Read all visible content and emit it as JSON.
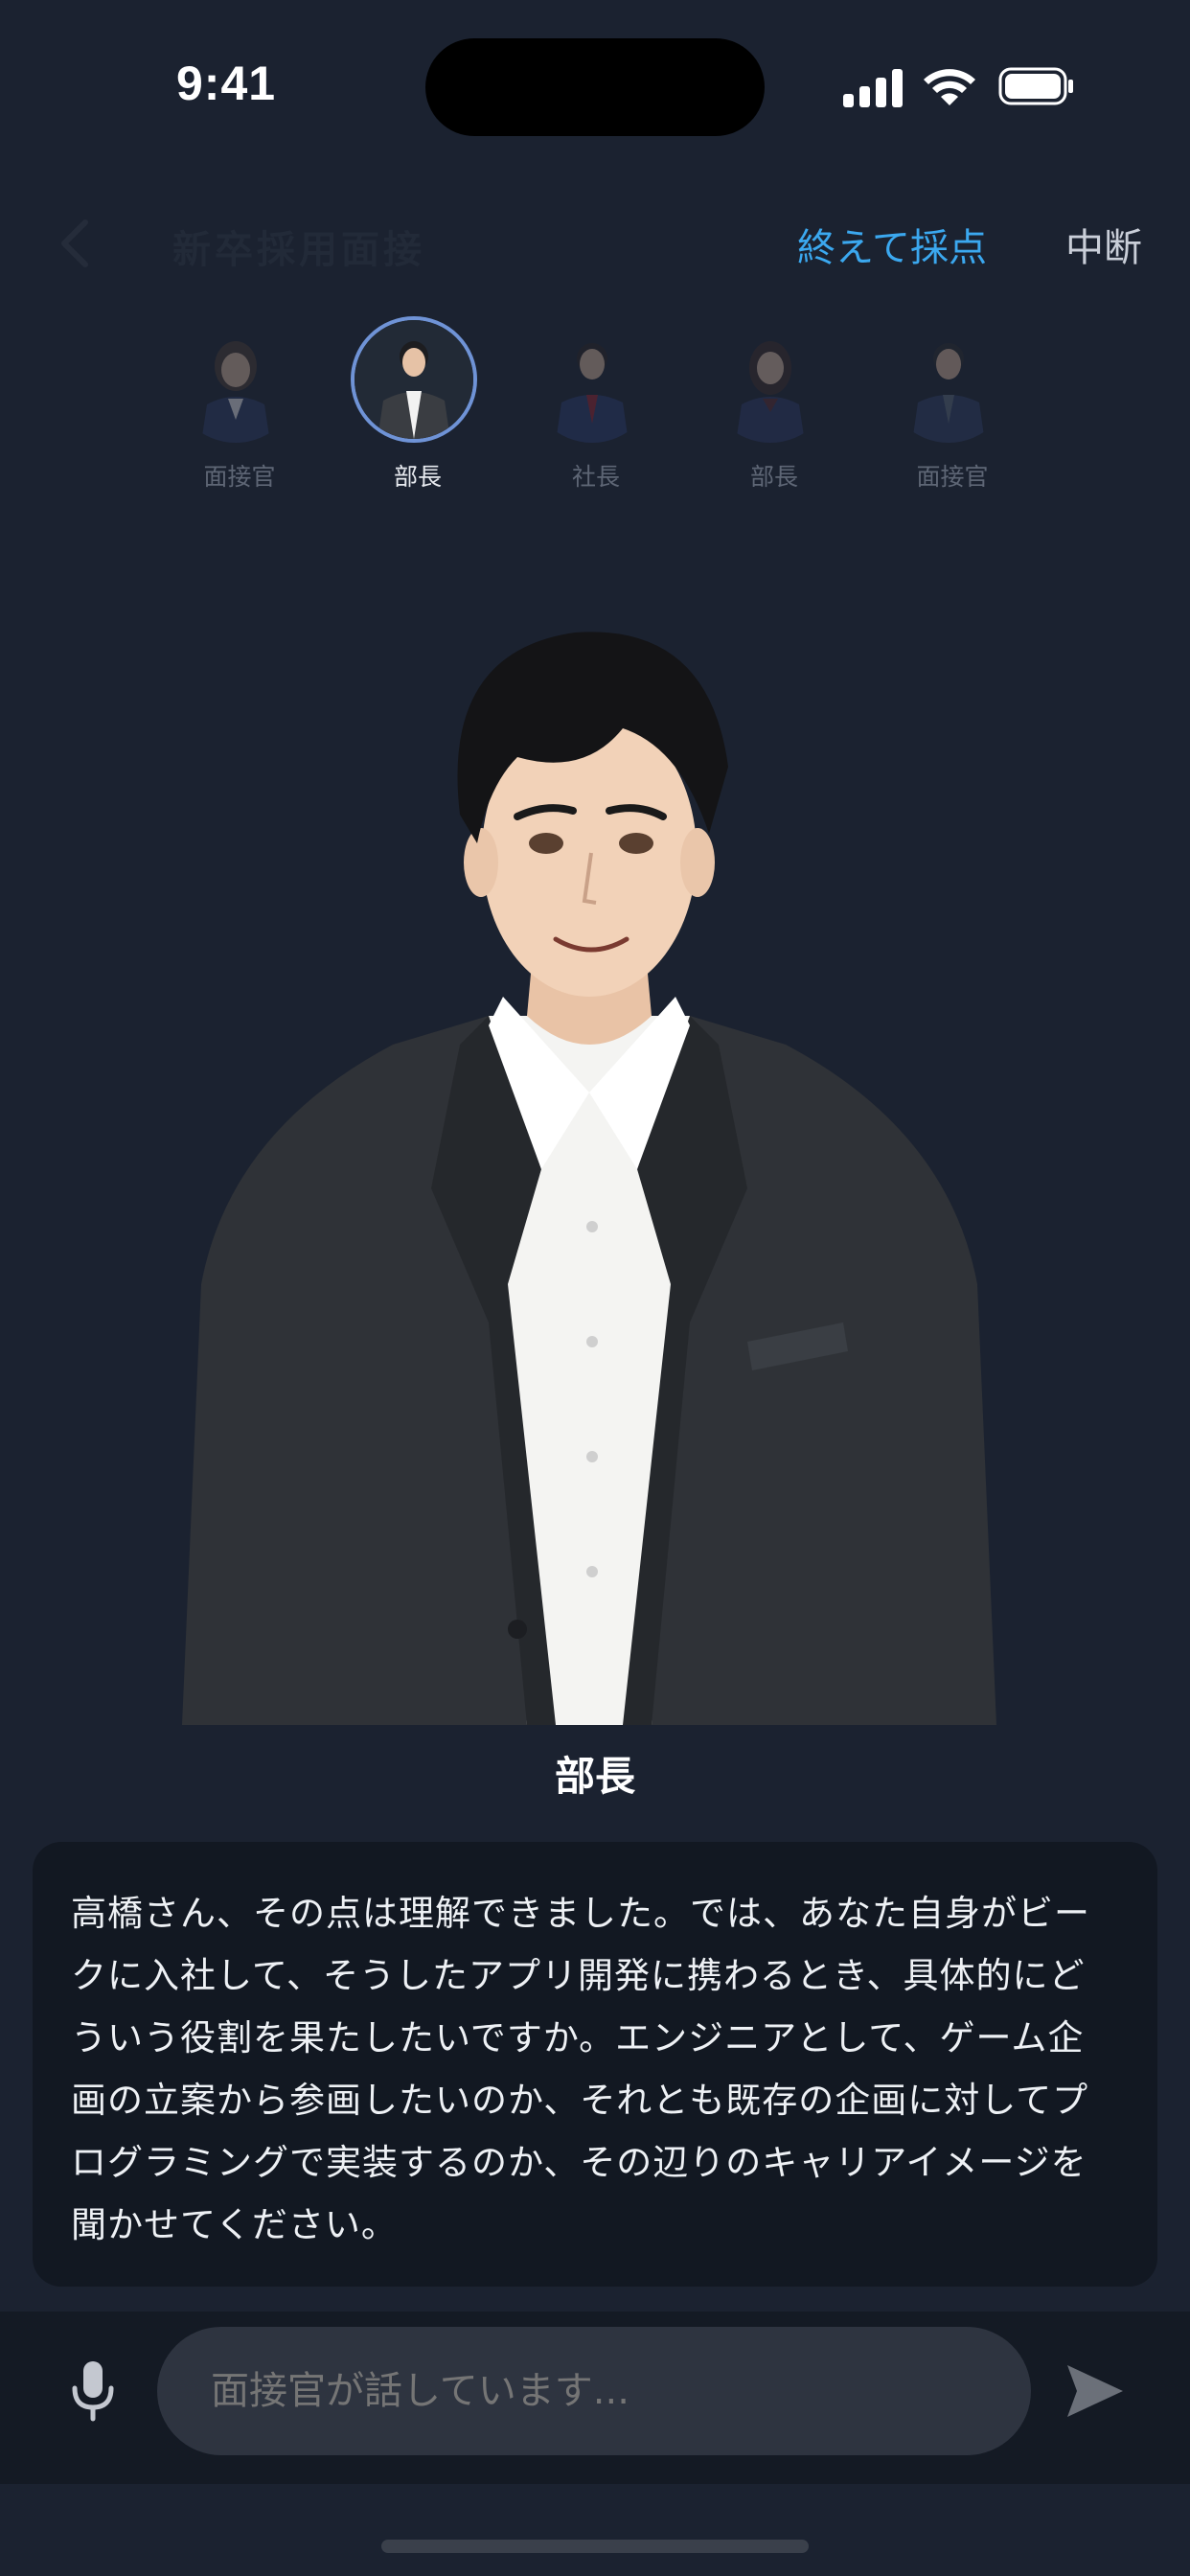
{
  "status_bar": {
    "time": "9:41"
  },
  "nav": {
    "title": "新卒採用面接",
    "finish_label": "終えて採点",
    "abort_label": "中断"
  },
  "interviewers": [
    {
      "label": "面接官",
      "active": false
    },
    {
      "label": "部長",
      "active": true
    },
    {
      "label": "社長",
      "active": false
    },
    {
      "label": "部長",
      "active": false
    },
    {
      "label": "面接官",
      "active": false
    }
  ],
  "speaker": {
    "name": "部長"
  },
  "message": {
    "text": "高橋さん、その点は理解できました。では、あなた自身がビークに入社して、そうしたアプリ開発に携わるとき、具体的にどういう役割を果たしたいですか。エンジニアとして、ゲーム企画の立案から参画したいのか、それとも既存の企画に対してプログラミングで実装するのか、その辺りのキャリアイメージを聞かせてください。"
  },
  "input": {
    "placeholder": "面接官が話しています..."
  },
  "icons": {
    "back": "chevron-left-icon",
    "mic": "microphone-icon",
    "send": "send-icon"
  },
  "colors": {
    "background": "#1b2230",
    "accent": "#3ba8ef",
    "active_ring": "#6f93d6",
    "card": "#121822",
    "input_bg": "#2e3440"
  }
}
